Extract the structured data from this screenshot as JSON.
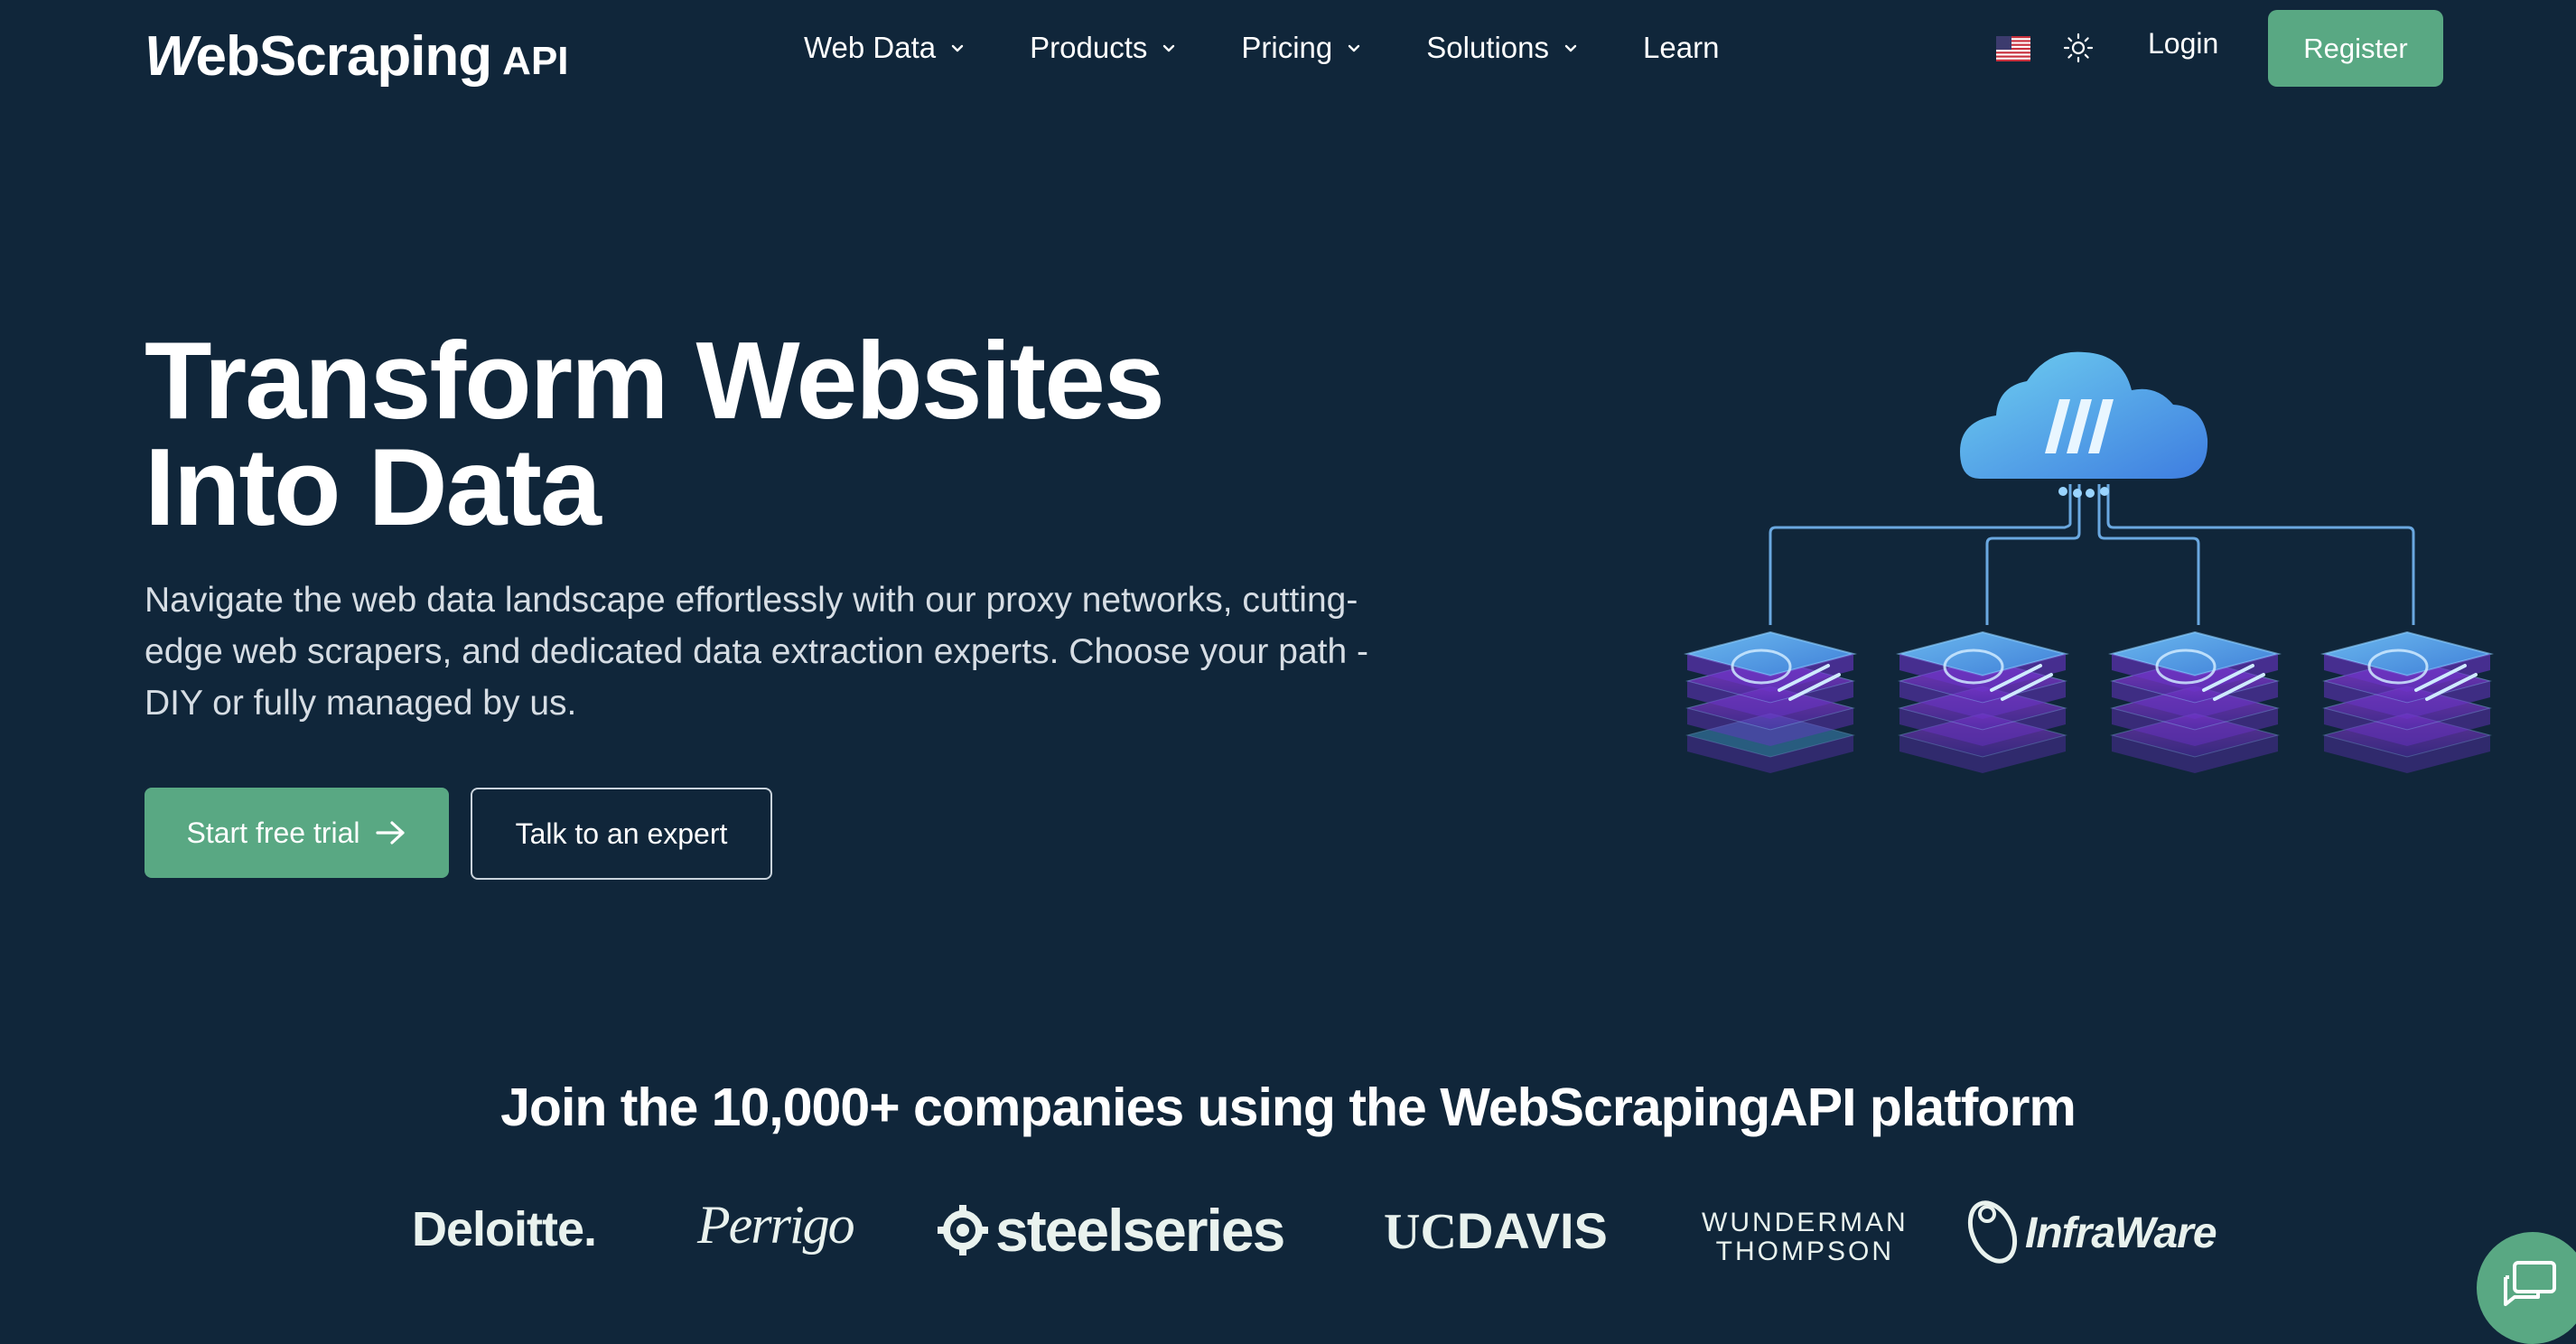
{
  "header": {
    "logo_mark": "W",
    "logo_text": "ebScraping",
    "logo_api": "API",
    "nav": [
      {
        "label": "Web Data",
        "has_dropdown": true
      },
      {
        "label": "Products",
        "has_dropdown": true
      },
      {
        "label": "Pricing",
        "has_dropdown": true
      },
      {
        "label": "Solutions",
        "has_dropdown": true
      },
      {
        "label": "Learn",
        "has_dropdown": false
      }
    ],
    "language_icon": "us-flag-icon",
    "theme_icon": "sun-icon",
    "login_label": "Login",
    "register_label": "Register"
  },
  "hero": {
    "title_line1": "Transform Websites",
    "title_line2": "Into Data",
    "subtitle": "Navigate the web data landscape effortlessly with our proxy networks, cutting-edge web scrapers, and dedicated data extraction experts. Choose your path - DIY or fully managed by us.",
    "primary_cta": "Start free trial",
    "secondary_cta": "Talk to an expert",
    "illustration": {
      "cloud_icon": "cloud-logo-icon",
      "server_icons": [
        "google-icon",
        "amazon-icon",
        "ebay-icon",
        "globe-icon"
      ]
    }
  },
  "companies": {
    "title": "Join the 10,000+ companies using the WebScrapingAPI platform",
    "logos": {
      "deloitte": "Deloitte.",
      "perrigo": "Perrigo",
      "steelseries": "steelseries",
      "ucdavis_uc": "UC",
      "ucdavis_davis": "DAVIS",
      "wunderman_line1": "WUNDERMAN",
      "wunderman_line2": "THOMPSON",
      "infraware": "InfraWare"
    }
  },
  "chat_icon": "chat-bubble-icon",
  "colors": {
    "background": "#10263a",
    "accent_green": "#59a883",
    "text": "#ffffff",
    "subtext": "#d6dde4"
  }
}
